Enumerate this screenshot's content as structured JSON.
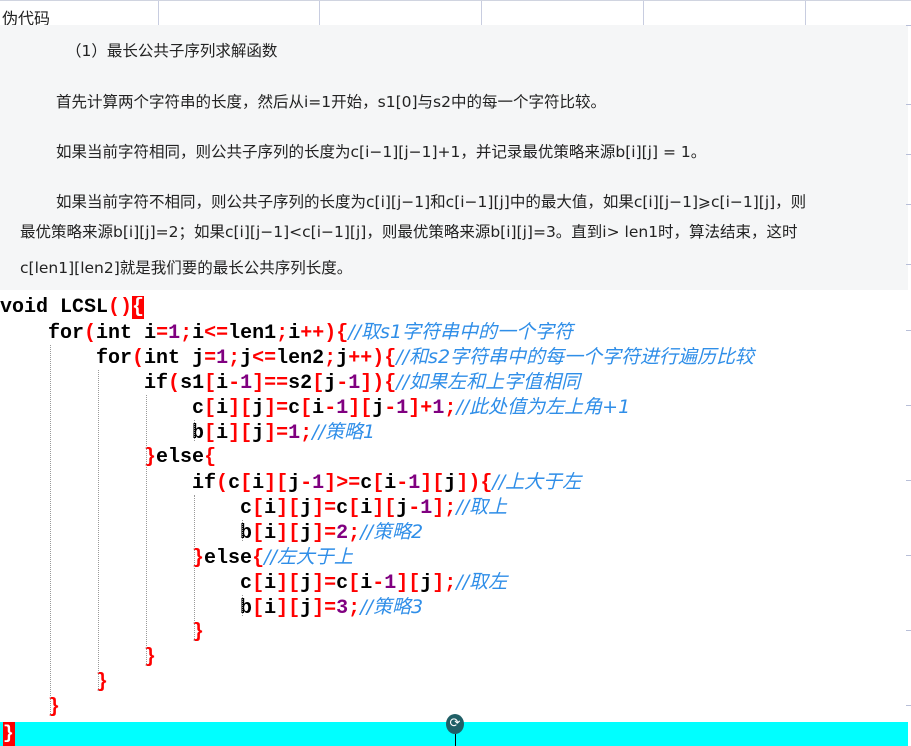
{
  "header": {
    "title": "伪代码"
  },
  "doc": {
    "heading": "（1）最长公共子序列求解函数",
    "p1": "首先计算两个字符串的长度，然后从i=1开始，s1[0]与s2中的每一个字符比较。",
    "p2": "如果当前字符相同，则公共子序列的长度为c[i−1][j−1]+1，并记录最优策略来源b[i][j] = 1。",
    "p3a": "如果当前字符不相同，则公共子序列的长度为c[i][j−1]和c[i−1][j]中的最大值，如果c[i][j−1]⩾c[i−1][j]，则",
    "p3b": "最优策略来源b[i][j]=2；如果c[i][j−1]<c[i−1][j]，则最优策略来源b[i][j]=3。直到i> len1时，算法结束，这时",
    "p3c": "c[len1][len2]就是我们要的最长公共序列长度。"
  },
  "code": [
    {
      "indent": 0,
      "tokens": [
        [
          "kw",
          "void LCSL"
        ],
        [
          "br",
          "()"
        ],
        [
          "hl",
          "{"
        ]
      ]
    },
    {
      "indent": 1,
      "tokens": [
        [
          "kw",
          "for"
        ],
        [
          "br",
          "("
        ],
        [
          "kw",
          "int "
        ],
        [
          "id",
          "i"
        ],
        [
          "op",
          "="
        ],
        [
          "num",
          "1"
        ],
        [
          "op",
          ";"
        ],
        [
          "id",
          "i"
        ],
        [
          "op",
          "<="
        ],
        [
          "id",
          "len1"
        ],
        [
          "op",
          ";"
        ],
        [
          "id",
          "i"
        ],
        [
          "op",
          "++"
        ],
        [
          "br",
          ")"
        ],
        [
          "br",
          "{"
        ],
        [
          "cm",
          "//取s1字符串中的一个字符"
        ]
      ]
    },
    {
      "indent": 2,
      "tokens": [
        [
          "kw",
          "for"
        ],
        [
          "br",
          "("
        ],
        [
          "kw",
          "int "
        ],
        [
          "id",
          "j"
        ],
        [
          "op",
          "="
        ],
        [
          "num",
          "1"
        ],
        [
          "op",
          ";"
        ],
        [
          "id",
          "j"
        ],
        [
          "op",
          "<="
        ],
        [
          "id",
          "len2"
        ],
        [
          "op",
          ";"
        ],
        [
          "id",
          "j"
        ],
        [
          "op",
          "++"
        ],
        [
          "br",
          ")"
        ],
        [
          "br",
          "{"
        ],
        [
          "cm",
          "//和s2字符串中的每一个字符进行遍历比较"
        ]
      ]
    },
    {
      "indent": 3,
      "tokens": [
        [
          "kw",
          "if"
        ],
        [
          "br",
          "("
        ],
        [
          "id",
          "s1"
        ],
        [
          "br",
          "["
        ],
        [
          "id",
          "i"
        ],
        [
          "op",
          "-"
        ],
        [
          "num",
          "1"
        ],
        [
          "br",
          "]"
        ],
        [
          "op",
          "=="
        ],
        [
          "id",
          "s2"
        ],
        [
          "br",
          "["
        ],
        [
          "id",
          "j"
        ],
        [
          "op",
          "-"
        ],
        [
          "num",
          "1"
        ],
        [
          "br",
          "]"
        ],
        [
          "br",
          ")"
        ],
        [
          "br",
          "{"
        ],
        [
          "cm",
          "//如果左和上字值相同"
        ]
      ]
    },
    {
      "indent": 4,
      "tokens": [
        [
          "id",
          "c"
        ],
        [
          "br",
          "["
        ],
        [
          "id",
          "i"
        ],
        [
          "br",
          "]["
        ],
        [
          "id",
          "j"
        ],
        [
          "br",
          "]"
        ],
        [
          "op",
          "="
        ],
        [
          "id",
          "c"
        ],
        [
          "br",
          "["
        ],
        [
          "id",
          "i"
        ],
        [
          "op",
          "-"
        ],
        [
          "num",
          "1"
        ],
        [
          "br",
          "]["
        ],
        [
          "id",
          "j"
        ],
        [
          "op",
          "-"
        ],
        [
          "num",
          "1"
        ],
        [
          "br",
          "]"
        ],
        [
          "op",
          "+"
        ],
        [
          "num",
          "1"
        ],
        [
          "op",
          ";"
        ],
        [
          "cm",
          "//此处值为左上角+1"
        ]
      ]
    },
    {
      "indent": 4,
      "tokens": [
        [
          "id",
          "b"
        ],
        [
          "br",
          "["
        ],
        [
          "id",
          "i"
        ],
        [
          "br",
          "]["
        ],
        [
          "id",
          "j"
        ],
        [
          "br",
          "]"
        ],
        [
          "op",
          "="
        ],
        [
          "num",
          "1"
        ],
        [
          "op",
          ";"
        ],
        [
          "cm",
          "//策略1"
        ]
      ]
    },
    {
      "indent": 3,
      "tokens": [
        [
          "br",
          "}"
        ],
        [
          "kw",
          "else"
        ],
        [
          "br",
          "{"
        ]
      ]
    },
    {
      "indent": 4,
      "tokens": [
        [
          "kw",
          "if"
        ],
        [
          "br",
          "("
        ],
        [
          "id",
          "c"
        ],
        [
          "br",
          "["
        ],
        [
          "id",
          "i"
        ],
        [
          "br",
          "]["
        ],
        [
          "id",
          "j"
        ],
        [
          "op",
          "-"
        ],
        [
          "num",
          "1"
        ],
        [
          "br",
          "]"
        ],
        [
          "op",
          ">="
        ],
        [
          "id",
          "c"
        ],
        [
          "br",
          "["
        ],
        [
          "id",
          "i"
        ],
        [
          "op",
          "-"
        ],
        [
          "num",
          "1"
        ],
        [
          "br",
          "]["
        ],
        [
          "id",
          "j"
        ],
        [
          "br",
          "]"
        ],
        [
          "br",
          ")"
        ],
        [
          "br",
          "{"
        ],
        [
          "cm",
          "//上大于左"
        ]
      ]
    },
    {
      "indent": 5,
      "tokens": [
        [
          "id",
          "c"
        ],
        [
          "br",
          "["
        ],
        [
          "id",
          "i"
        ],
        [
          "br",
          "]["
        ],
        [
          "id",
          "j"
        ],
        [
          "br",
          "]"
        ],
        [
          "op",
          "="
        ],
        [
          "id",
          "c"
        ],
        [
          "br",
          "["
        ],
        [
          "id",
          "i"
        ],
        [
          "br",
          "]["
        ],
        [
          "id",
          "j"
        ],
        [
          "op",
          "-"
        ],
        [
          "num",
          "1"
        ],
        [
          "br",
          "]"
        ],
        [
          "op",
          ";"
        ],
        [
          "cm",
          "//取上"
        ]
      ]
    },
    {
      "indent": 5,
      "tokens": [
        [
          "id",
          "b"
        ],
        [
          "br",
          "["
        ],
        [
          "id",
          "i"
        ],
        [
          "br",
          "]["
        ],
        [
          "id",
          "j"
        ],
        [
          "br",
          "]"
        ],
        [
          "op",
          "="
        ],
        [
          "num",
          "2"
        ],
        [
          "op",
          ";"
        ],
        [
          "cm",
          "//策略2"
        ]
      ]
    },
    {
      "indent": 4,
      "tokens": [
        [
          "br",
          "}"
        ],
        [
          "kw",
          "else"
        ],
        [
          "br",
          "{"
        ],
        [
          "cm",
          "//左大于上"
        ]
      ]
    },
    {
      "indent": 5,
      "tokens": [
        [
          "id",
          "c"
        ],
        [
          "br",
          "["
        ],
        [
          "id",
          "i"
        ],
        [
          "br",
          "]["
        ],
        [
          "id",
          "j"
        ],
        [
          "br",
          "]"
        ],
        [
          "op",
          "="
        ],
        [
          "id",
          "c"
        ],
        [
          "br",
          "["
        ],
        [
          "id",
          "i"
        ],
        [
          "op",
          "-"
        ],
        [
          "num",
          "1"
        ],
        [
          "br",
          "]["
        ],
        [
          "id",
          "j"
        ],
        [
          "br",
          "]"
        ],
        [
          "op",
          ";"
        ],
        [
          "cm",
          "//取左"
        ]
      ]
    },
    {
      "indent": 5,
      "tokens": [
        [
          "id",
          "b"
        ],
        [
          "br",
          "["
        ],
        [
          "id",
          "i"
        ],
        [
          "br",
          "]["
        ],
        [
          "id",
          "j"
        ],
        [
          "br",
          "]"
        ],
        [
          "op",
          "="
        ],
        [
          "num",
          "3"
        ],
        [
          "op",
          ";"
        ],
        [
          "cm",
          "//策略3"
        ]
      ]
    },
    {
      "indent": 4,
      "tokens": [
        [
          "br",
          "}"
        ]
      ]
    },
    {
      "indent": 3,
      "tokens": [
        [
          "br",
          "}"
        ]
      ]
    },
    {
      "indent": 2,
      "tokens": [
        [
          "br",
          "}"
        ]
      ]
    },
    {
      "indent": 1,
      "tokens": [
        [
          "br",
          "}"
        ]
      ]
    }
  ],
  "end_brace": "}",
  "colors": {
    "comment": "#2f8ee8",
    "bracket": "#ff0000",
    "number": "#800080",
    "highlight": "#00ffff"
  }
}
